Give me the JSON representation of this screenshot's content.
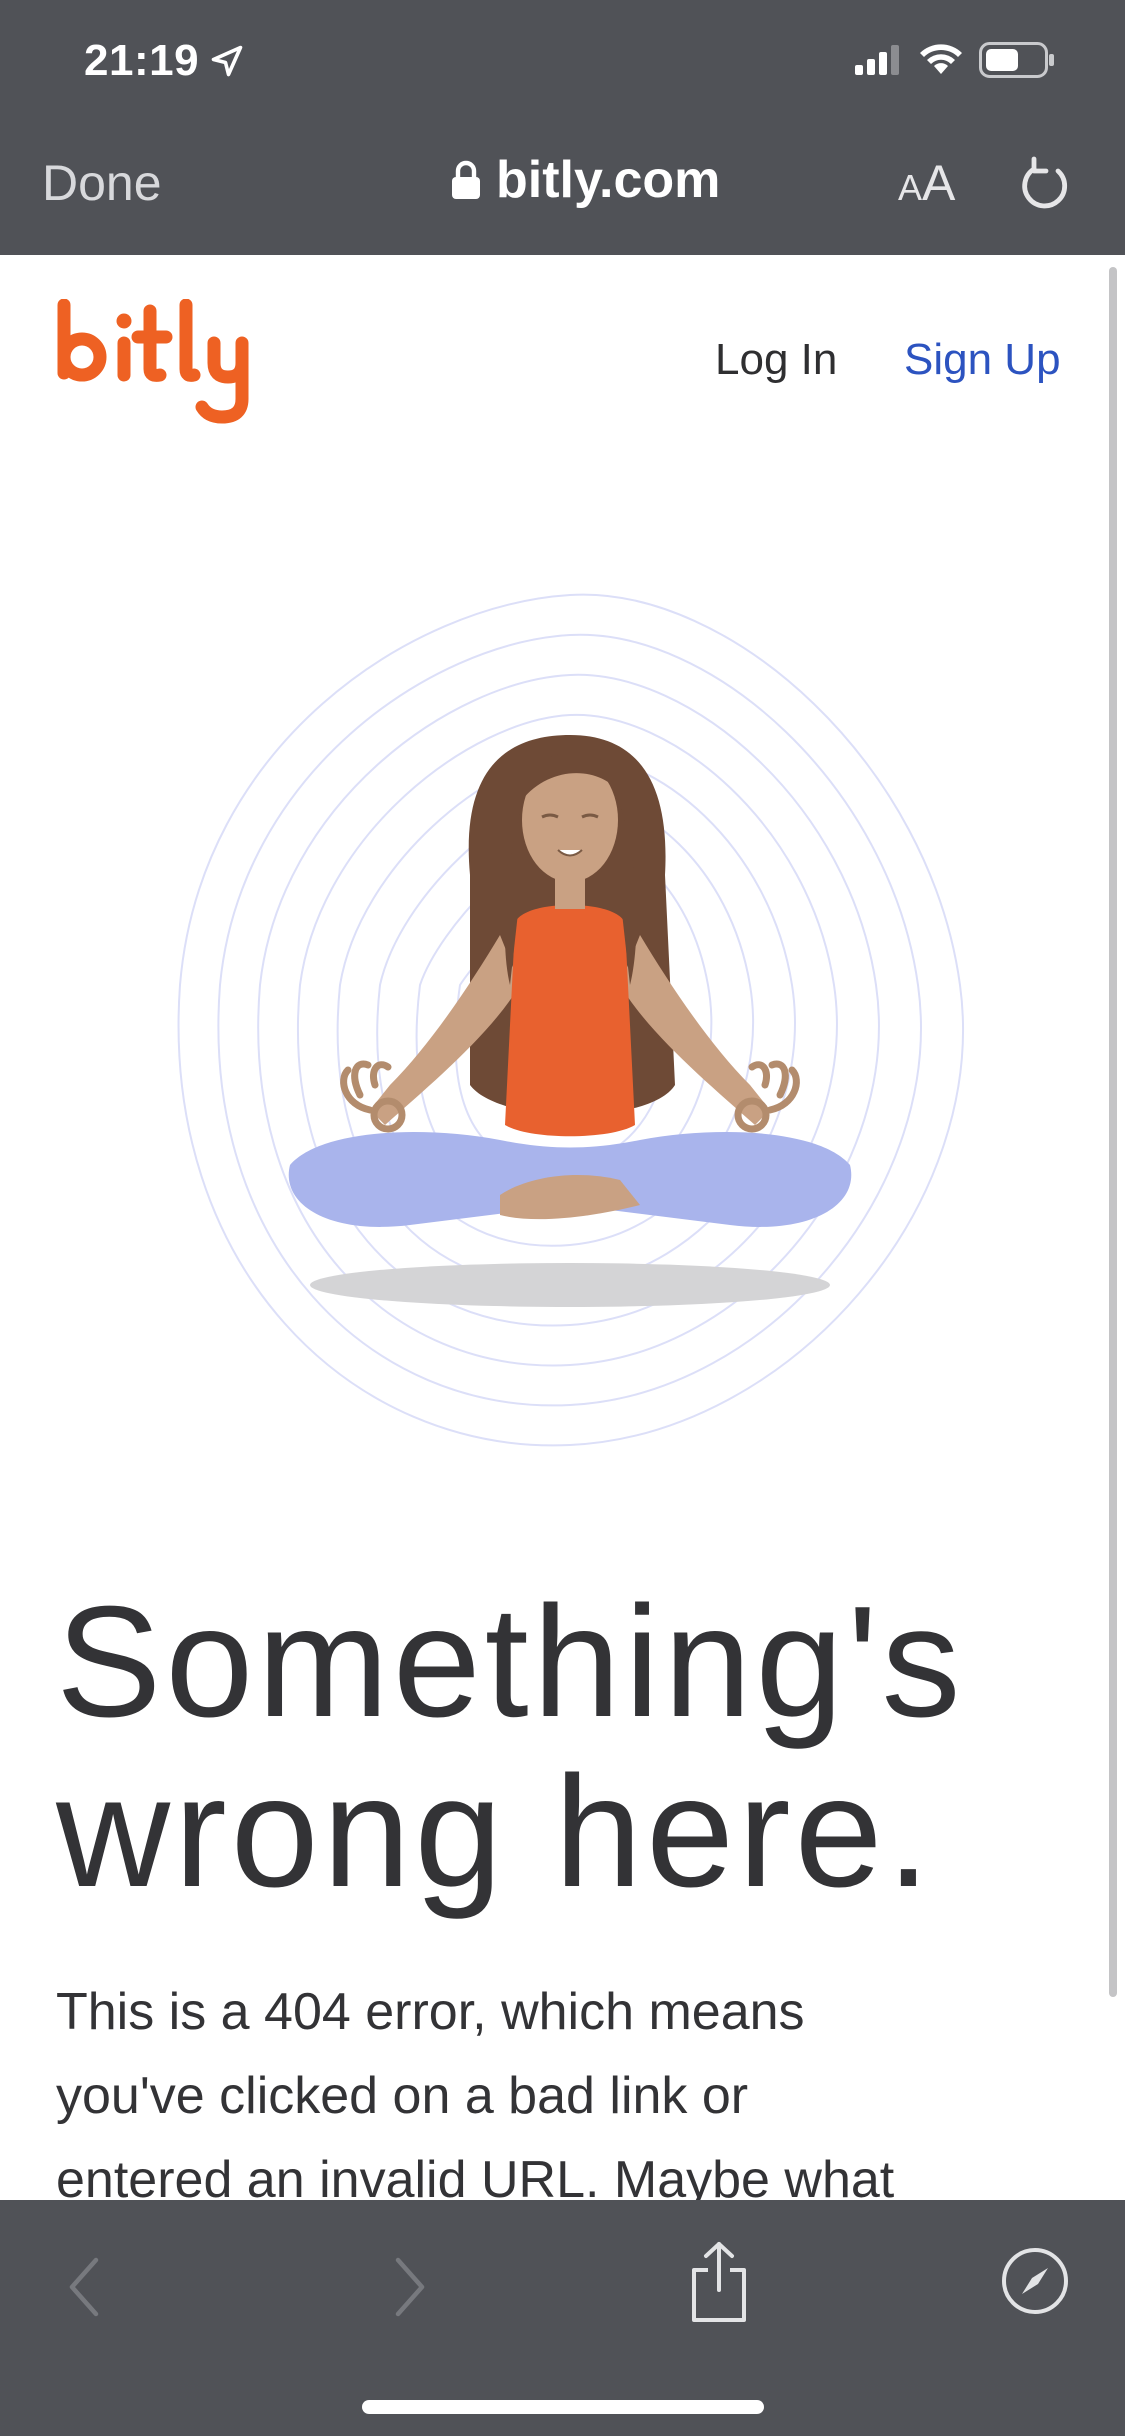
{
  "status_bar": {
    "time": "21:19"
  },
  "safari": {
    "done_label": "Done",
    "domain": "bitly.com",
    "aa_small": "A",
    "aa_large": "A"
  },
  "site": {
    "logo_text": "bitly",
    "login_label": "Log In",
    "signup_label": "Sign Up",
    "brand_color": "#EE6123",
    "link_color": "#2C53C0"
  },
  "content": {
    "headline_line1": "Something's",
    "headline_line2": "wrong here.",
    "body_line1": "This is a 404 error, which means",
    "body_line2": "you've clicked on a bad link or",
    "body_line3": "entered an invalid URL. Maybe what"
  },
  "toolbar": {
    "back_icon": "chevron-left-icon",
    "forward_icon": "chevron-right-icon",
    "share_icon": "share-icon",
    "safari_icon": "compass-icon"
  }
}
